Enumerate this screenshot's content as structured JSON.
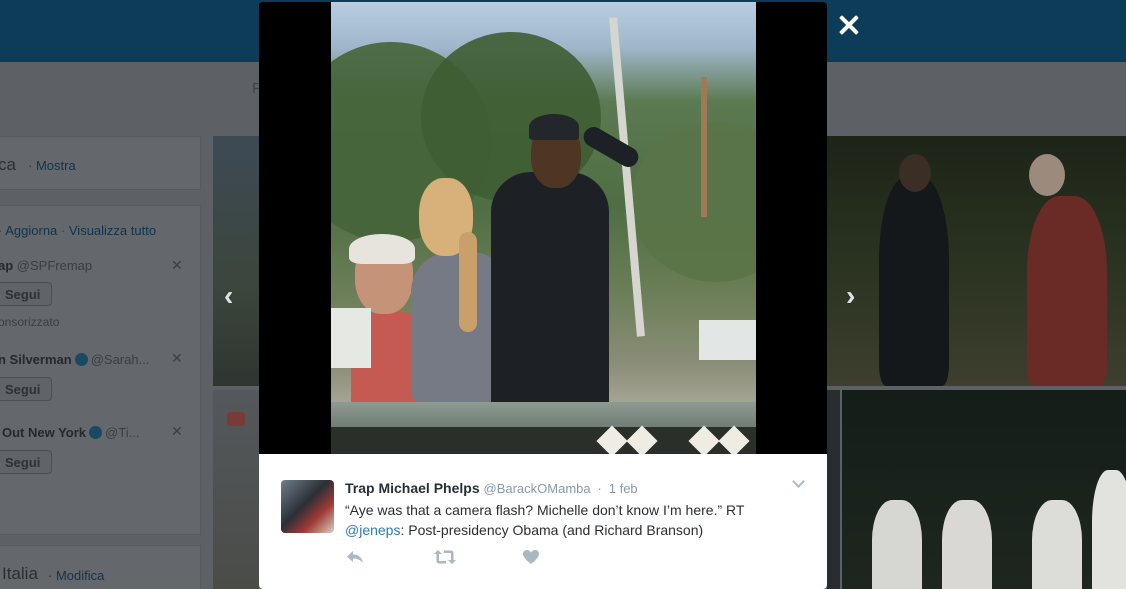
{
  "background": {
    "nav_hint": "F",
    "search_suffix": "ca",
    "search_show": "Mostra",
    "suggestions_refresh": "Aggiorna",
    "suggestions_separator": "·",
    "suggestions_view_all": "Visualizza tutto",
    "suggestions": [
      {
        "name": "ap",
        "handle": "@SPFremap",
        "follow_label": "Segui",
        "note": "onsorizzato"
      },
      {
        "name": "n Silverman",
        "handle": "@Sarah...",
        "follow_label": "Segui"
      },
      {
        "name": "Out New York",
        "handle": "@Ti...",
        "follow_label": "Segui"
      }
    ],
    "trends_title": "Italia",
    "trends_edit": "Modifica"
  },
  "lightbox": {
    "prev_arrow": "‹",
    "next_arrow": "›",
    "tweet": {
      "name": "Trap Michael Phelps",
      "handle": "@BarackOMamba",
      "separator": "·",
      "time": "1 feb",
      "text_part1": "“Aye was that a camera flash? Michelle don’t know I’m here.” RT ",
      "mention": "@jeneps",
      "text_part2": ": Post-presidency Obama (and Richard Branson)"
    },
    "icons": {
      "close": "close-icon",
      "chevron": "chevron-down-icon",
      "reply": "reply-icon",
      "retweet": "retweet-icon",
      "like": "heart-icon"
    }
  },
  "colors": {
    "link": "#2b7bb9",
    "topbar": "#0c3c58",
    "muted": "#8899a6"
  }
}
